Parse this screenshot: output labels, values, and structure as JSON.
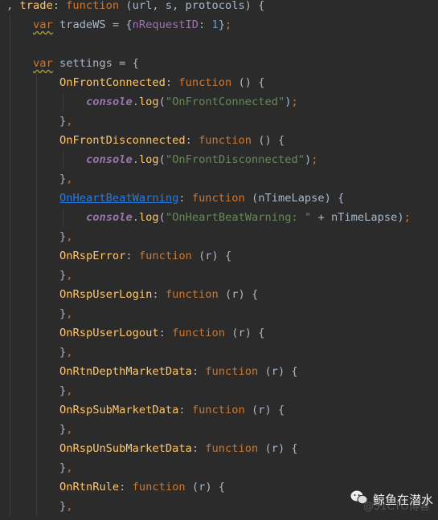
{
  "colors": {
    "background": "#2b2b2b",
    "keyword": "#cc7832",
    "function_name": "#ffc66d",
    "string": "#6a8759",
    "property": "#9876aa",
    "number": "#6897bb",
    "default": "#a9b7c6",
    "link": "#287bde"
  },
  "code_lines": [
    {
      "indent": 0,
      "tokens": [
        {
          "t": ", "
        },
        {
          "t": "trade",
          "c": "fn"
        },
        {
          "t": ": "
        },
        {
          "t": "function",
          "c": "kw"
        },
        {
          "t": " (url, s, protocols) {"
        }
      ]
    },
    {
      "indent": 1,
      "tokens": [
        {
          "t": "var",
          "c": "kw warn"
        },
        {
          "t": " tradeWS = {"
        },
        {
          "t": "nRequestID",
          "c": "prop"
        },
        {
          "t": ": "
        },
        {
          "t": "1",
          "c": "num"
        },
        {
          "t": "}"
        },
        {
          "t": ";",
          "c": "kw"
        }
      ]
    },
    {
      "indent": 1,
      "tokens": []
    },
    {
      "indent": 1,
      "tokens": [
        {
          "t": "var",
          "c": "kw warn"
        },
        {
          "t": " settings = {"
        }
      ]
    },
    {
      "indent": 2,
      "tokens": [
        {
          "t": "OnFrontConnected",
          "c": "fn"
        },
        {
          "t": ": "
        },
        {
          "t": "function",
          "c": "kw"
        },
        {
          "t": " () {"
        }
      ]
    },
    {
      "indent": 3,
      "tokens": [
        {
          "t": "console",
          "c": "con"
        },
        {
          "t": "."
        },
        {
          "t": "log",
          "c": "fn"
        },
        {
          "t": "("
        },
        {
          "t": "\"OnFrontConnected\"",
          "c": "str"
        },
        {
          "t": ")"
        },
        {
          "t": ";",
          "c": "kw"
        }
      ]
    },
    {
      "indent": 2,
      "tokens": [
        {
          "t": "}"
        },
        {
          "t": ",",
          "c": "kw"
        }
      ]
    },
    {
      "indent": 2,
      "tokens": [
        {
          "t": "OnFrontDisconnected",
          "c": "fn"
        },
        {
          "t": ": "
        },
        {
          "t": "function",
          "c": "kw"
        },
        {
          "t": " () {"
        }
      ]
    },
    {
      "indent": 3,
      "tokens": [
        {
          "t": "console",
          "c": "con"
        },
        {
          "t": "."
        },
        {
          "t": "log",
          "c": "fn"
        },
        {
          "t": "("
        },
        {
          "t": "\"OnFrontDisconnected\"",
          "c": "str"
        },
        {
          "t": ")"
        },
        {
          "t": ";",
          "c": "kw"
        }
      ]
    },
    {
      "indent": 2,
      "tokens": [
        {
          "t": "}"
        },
        {
          "t": ",",
          "c": "kw"
        }
      ]
    },
    {
      "indent": 2,
      "tokens": [
        {
          "t": "OnHeartBeatWarning",
          "c": "link"
        },
        {
          "t": ": "
        },
        {
          "t": "function",
          "c": "kw"
        },
        {
          "t": " (nTimeLapse) {"
        }
      ]
    },
    {
      "indent": 3,
      "tokens": [
        {
          "t": "console",
          "c": "con"
        },
        {
          "t": "."
        },
        {
          "t": "log",
          "c": "fn"
        },
        {
          "t": "("
        },
        {
          "t": "\"OnHeartBeatWarning: \"",
          "c": "str"
        },
        {
          "t": " + nTimeLapse)"
        },
        {
          "t": ";",
          "c": "kw"
        }
      ]
    },
    {
      "indent": 2,
      "tokens": [
        {
          "t": "}"
        },
        {
          "t": ",",
          "c": "kw"
        }
      ]
    },
    {
      "indent": 2,
      "tokens": [
        {
          "t": "OnRspError",
          "c": "fn"
        },
        {
          "t": ": "
        },
        {
          "t": "function",
          "c": "kw"
        },
        {
          "t": " (r) {"
        }
      ]
    },
    {
      "indent": 2,
      "tokens": [
        {
          "t": "}"
        },
        {
          "t": ",",
          "c": "kw"
        }
      ]
    },
    {
      "indent": 2,
      "tokens": [
        {
          "t": "OnRspUserLogin",
          "c": "fn"
        },
        {
          "t": ": "
        },
        {
          "t": "function",
          "c": "kw"
        },
        {
          "t": " (r) {"
        }
      ]
    },
    {
      "indent": 2,
      "tokens": [
        {
          "t": "}"
        },
        {
          "t": ",",
          "c": "kw"
        }
      ]
    },
    {
      "indent": 2,
      "tokens": [
        {
          "t": "OnRspUserLogout",
          "c": "fn"
        },
        {
          "t": ": "
        },
        {
          "t": "function",
          "c": "kw"
        },
        {
          "t": " (r) {"
        }
      ]
    },
    {
      "indent": 2,
      "tokens": [
        {
          "t": "}"
        },
        {
          "t": ",",
          "c": "kw"
        }
      ]
    },
    {
      "indent": 2,
      "tokens": [
        {
          "t": "OnRtnDepthMarketData",
          "c": "fn"
        },
        {
          "t": ": "
        },
        {
          "t": "function",
          "c": "kw"
        },
        {
          "t": " (r) {"
        }
      ]
    },
    {
      "indent": 2,
      "tokens": [
        {
          "t": "}"
        },
        {
          "t": ",",
          "c": "kw"
        }
      ]
    },
    {
      "indent": 2,
      "tokens": [
        {
          "t": "OnRspSubMarketData",
          "c": "fn"
        },
        {
          "t": ": "
        },
        {
          "t": "function",
          "c": "kw"
        },
        {
          "t": " (r) {"
        }
      ]
    },
    {
      "indent": 2,
      "tokens": [
        {
          "t": "}"
        },
        {
          "t": ",",
          "c": "kw"
        }
      ]
    },
    {
      "indent": 2,
      "tokens": [
        {
          "t": "OnRspUnSubMarketData",
          "c": "fn"
        },
        {
          "t": ": "
        },
        {
          "t": "function",
          "c": "kw"
        },
        {
          "t": " (r) {"
        }
      ]
    },
    {
      "indent": 2,
      "tokens": [
        {
          "t": "}"
        },
        {
          "t": ",",
          "c": "kw"
        }
      ]
    },
    {
      "indent": 2,
      "tokens": [
        {
          "t": "OnRtnRule",
          "c": "fn"
        },
        {
          "t": ": "
        },
        {
          "t": "function",
          "c": "kw"
        },
        {
          "t": " (r) {"
        }
      ]
    },
    {
      "indent": 2,
      "tokens": [
        {
          "t": "}"
        },
        {
          "t": ",",
          "c": "kw"
        }
      ]
    }
  ],
  "watermark": {
    "icon": "wechat-icon",
    "label": "鲸鱼在潜水",
    "sub": "@51CTO博客"
  }
}
